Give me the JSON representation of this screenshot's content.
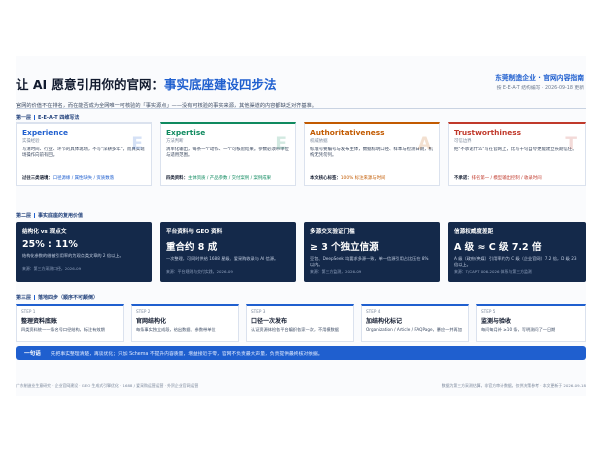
{
  "header": {
    "title_prefix": "让 AI 愿意引用你的官网：",
    "title_accent": "事实底座建设四步法",
    "brand": "东莞制造企业 · 官网内容指南",
    "brand_sub": "按 E-E-A-T 结构编写 · 2026-09-18 更新",
    "intro": "官网的价值不在排名，而在能否成为全网唯一可核验的「事实源点」——没有可核验的事实来源，其他渠道的内容都缺乏对齐基准。"
  },
  "section1": {
    "no": "第一层",
    "label": "E-E-A-T 四维写法"
  },
  "eeat": [
    {
      "name": "Experience",
      "sub": "实操经验",
      "desc": "写清时间、行业、环节的具体现场，不写\"深耕多年\"，而真实现场操作向前有回。",
      "foot_key": "过往三类语境：",
      "foot_val": "口径源缘 / 属性缺失 / 资质数落",
      "letter": "E",
      "color": "#1f5fcf"
    },
    {
      "name": "Expertise",
      "sub": "方法判断",
      "desc": "清单化输出，每条一个动作、一个可核验结果。参数必须带单位与适用范围。",
      "foot_key": "四类资料：",
      "foot_val": "主体资质 / 产品参数 / 交付案例 / 案例成果",
      "letter": "E",
      "color": "#0f8a5f"
    },
    {
      "name": "Authoritativeness",
      "sub": "权威依据",
      "desc": "标准号要编号与发布主体，数据标明口径、样本与检测日期，机构无凭勿列。",
      "foot_key": "本文核心标签：",
      "foot_val": "100% 标注来源与时间",
      "letter": "A",
      "color": "#c25a00"
    },
    {
      "name": "Trustworthiness",
      "sub": "可信边界",
      "desc": "把\"不承诺什么\"写在官网上，比写十句自夸更能建立长期信任。",
      "foot_key": "不承诺：",
      "foot_val": "排名第一 / 模型输出控制 / 收录时间",
      "letter": "T",
      "color": "#c0392b"
    }
  ],
  "section2": {
    "no": "第二层",
    "label": "事实底座的复用价值"
  },
  "reuse": [
    {
      "head": "结构化 vs 观点文",
      "big": "25% : 11%",
      "desc": "结构化参数的借被引用率的为观点类文章的 2 倍以上。",
      "src": "来源：第三方采测口径，2026-09"
    },
    {
      "head": "平台资料与 GEO 资料",
      "big": "重合约 8 成",
      "desc": "一次整理，可同时供给 1688 星级、爱采购收录与 AI 信源。",
      "src": "来源：平台规则与交付实践，2026-09"
    },
    {
      "head": "多源交叉验证门槛",
      "big": "≥ 3 个独立信源",
      "desc": "豆包、DeepSeek 均要求多源一致，单一信源引用占比压在 8% 以内。",
      "src": "来源：第三方监测，2026-09"
    },
    {
      "head": "信源权威度差距",
      "big": "A 级 ≈ C 级 7.2 倍",
      "desc": "A 级（政府/央媒）引用率约为 C 级（企业官网）7.2 倍，D 级 23 倍以上。",
      "src": "来源：T/CAPT 006-2026 体系与第三方监测"
    }
  ],
  "section3": {
    "no": "第三层",
    "label": "落地四步（顺序不可颠倒）"
  },
  "steps": [
    {
      "no": "STEP 1",
      "head": "整理资料底账",
      "desc": "四类资料统一一条名号口径结构，标注有效期"
    },
    {
      "no": "STEP 2",
      "head": "官网结构化",
      "desc": "每条事实独立成段，给出数据、参数带单位"
    },
    {
      "no": "STEP 3",
      "head": "口径一次发布",
      "desc": "认证资源体检各平台编织各家一次，不用模数据"
    },
    {
      "no": "STEP 4",
      "head": "加结构化标记",
      "desc": "Organization / Article / FAQPage，暴应一并再加"
    },
    {
      "no": "STEP 5",
      "head": "监测与验收",
      "desc": "每问每月补 ≥10 条，写明测问了一日期"
    }
  ],
  "summary": {
    "key": "一句话",
    "text": "先把事实整理清楚，再谈优化；只加 Schema 不提升内容质量，增益接近于零，官网不负责最大声量，负责提供最终核对依据。"
  },
  "footer": {
    "left": "广东制造业生意研究 · 企业官网建设 · GEO 生成式引擎优化 · 1688 / 爱采购运营运营 · 外贸企业官网运营",
    "right": "数据为第三方采测估算，非官方审计数据，仅供决策参考 · 本文更新于 2026-09-18"
  }
}
